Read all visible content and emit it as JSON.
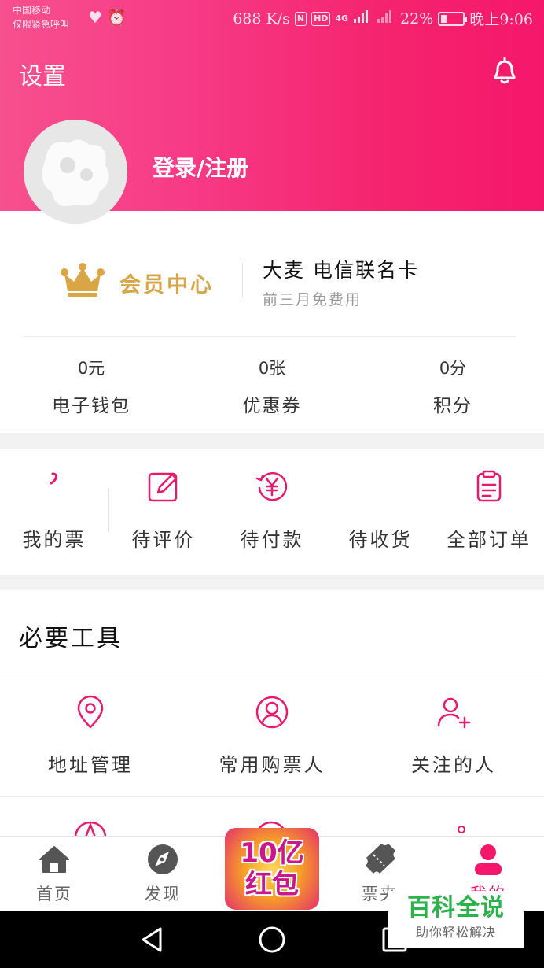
{
  "status_bar": {
    "carrier_line1": "中国移动",
    "carrier_line2": "仅限紧急呼叫",
    "left_icons": [
      "heart-pulse-icon",
      "alarm-icon"
    ],
    "speed": "688 K/s",
    "nfc": "N",
    "hd": "HD",
    "network": "4G",
    "battery_text": "22%",
    "battery_level": 0.22,
    "time": "晚上9:06"
  },
  "header": {
    "title": "设置",
    "bell_icon": "bell-icon",
    "login_label": "登录/注册"
  },
  "member": {
    "crown_icon": "crown-icon",
    "vip_label": "会员中心",
    "card_title": "大麦 电信联名卡",
    "card_subtitle": "前三月免费用"
  },
  "stats": [
    {
      "value": "0元",
      "label": "电子钱包"
    },
    {
      "value": "0张",
      "label": "优惠券"
    },
    {
      "value": "0分",
      "label": "积分"
    }
  ],
  "orders": [
    {
      "icon": "ticket-icon",
      "label": "我的票"
    },
    {
      "icon": "edit-icon",
      "label": "待评价"
    },
    {
      "icon": "yuan-refresh-icon",
      "label": "待付款"
    },
    {
      "icon": "delivery-icon",
      "label": "待收货"
    },
    {
      "icon": "order-list-icon",
      "label": "全部订单"
    }
  ],
  "tools": {
    "title": "必要工具",
    "items": [
      {
        "icon": "location-pin-icon",
        "label": "地址管理"
      },
      {
        "icon": "user-circle-icon",
        "label": "常用购票人"
      },
      {
        "icon": "user-add-icon",
        "label": "关注的人"
      }
    ]
  },
  "tabbar": {
    "items": [
      {
        "icon": "home-icon",
        "label": "首页",
        "active": false
      },
      {
        "icon": "compass-icon",
        "label": "发现",
        "active": false
      },
      {
        "icon": "ticket-tab-icon",
        "label": "票夹",
        "active": false
      },
      {
        "icon": "user-icon",
        "label": "我的",
        "active": true
      }
    ],
    "promo_text_1": "10亿",
    "promo_text_2": "红包"
  },
  "watermark": {
    "main": "百科全说",
    "sub": "助你轻松解决"
  },
  "colors": {
    "brand_pink": "#f5176b",
    "gold": "#d6a64b",
    "watermark_green": "#2cb24a"
  }
}
